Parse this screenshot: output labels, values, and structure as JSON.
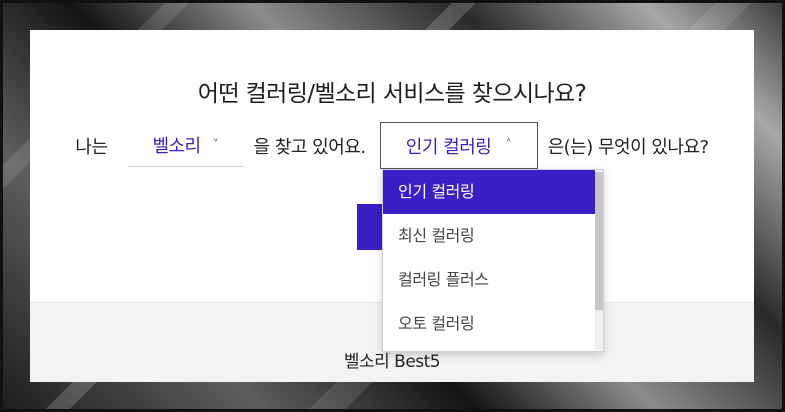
{
  "question": "어떤 컬러링/벨소리 서비스를 찾으시나요?",
  "sentence": {
    "prefix": "나는",
    "middle": "을 찾고 있어요.",
    "suffix": "은(는) 무엇이 있나요?"
  },
  "brand_select": {
    "value": "벨소리",
    "chevron": "˅"
  },
  "service_select": {
    "value": "인기 컬러링",
    "chevron": "˄"
  },
  "dropdown": {
    "options": [
      {
        "label": "인기 컬러링",
        "selected": true
      },
      {
        "label": "최신 컬러링",
        "selected": false
      },
      {
        "label": "컬러링 플러스",
        "selected": false
      },
      {
        "label": "오토 컬러링",
        "selected": false
      }
    ]
  },
  "footer": {
    "title": "벨소리 Best5"
  },
  "colors": {
    "accent": "#3a1fc7",
    "footer_bg": "#f3f3f4"
  },
  "icons": {
    "brand_chevron": "chevron-down-icon",
    "service_chevron": "chevron-up-icon"
  }
}
